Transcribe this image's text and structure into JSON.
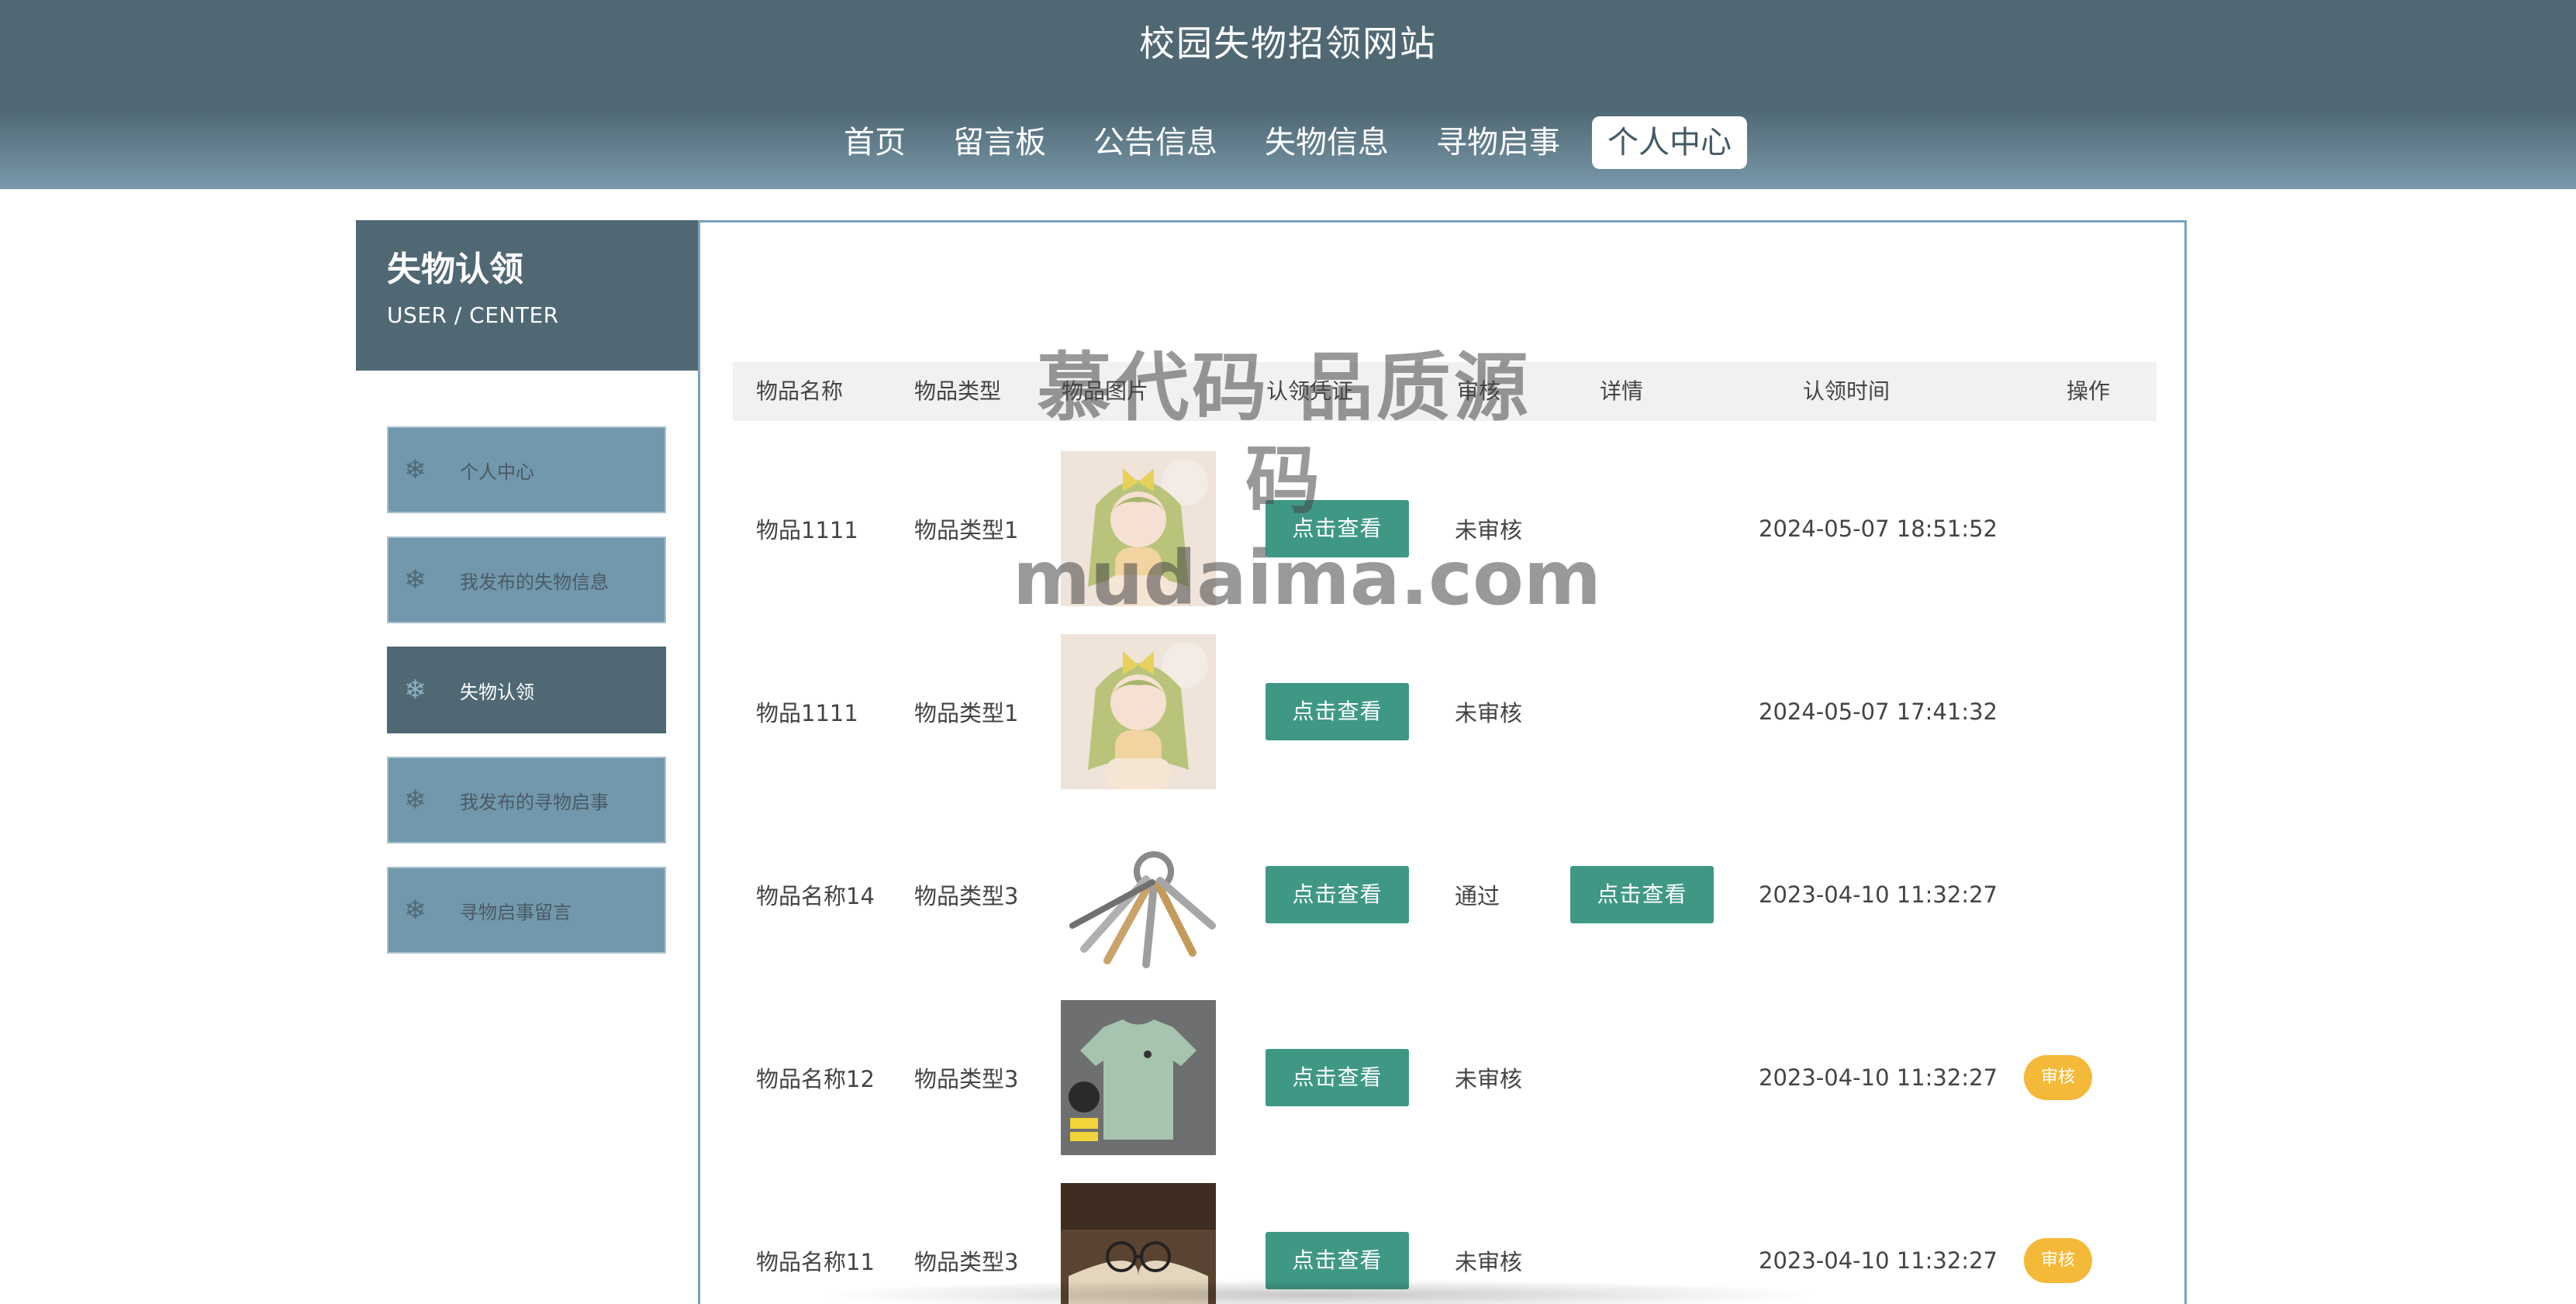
{
  "site": {
    "title": "校园失物招领网站"
  },
  "nav": {
    "items": [
      {
        "label": "首页"
      },
      {
        "label": "留言板"
      },
      {
        "label": "公告信息"
      },
      {
        "label": "失物信息"
      },
      {
        "label": "寻物启事"
      },
      {
        "label": "个人中心",
        "active": true
      }
    ]
  },
  "sidebar": {
    "title": "失物认领",
    "subtitle": "USER / CENTER",
    "items": [
      {
        "label": "个人中心",
        "icon": "snowflake-icon"
      },
      {
        "label": "我发布的失物信息",
        "icon": "snowflake-icon"
      },
      {
        "label": "失物认领",
        "icon": "snowflake-icon",
        "active": true
      },
      {
        "label": "我发布的寻物启事",
        "icon": "snowflake-icon"
      },
      {
        "label": "寻物启事留言",
        "icon": "snowflake-icon"
      }
    ]
  },
  "table": {
    "headers": {
      "name": "物品名称",
      "type": "物品类型",
      "image": "物品图片",
      "proof": "认领凭证",
      "audit": "审核",
      "detail": "详情",
      "time": "认领时间",
      "action": "操作"
    },
    "rows": [
      {
        "name": "物品1111",
        "type": "物品类型1",
        "image": "anime-girl-image",
        "proof_button": "点击查看",
        "audit": "未审核",
        "detail_button": "",
        "time": "2024-05-07 18:51:52",
        "action_button": ""
      },
      {
        "name": "物品1111",
        "type": "物品类型1",
        "image": "anime-girl-image",
        "proof_button": "点击查看",
        "audit": "未审核",
        "detail_button": "",
        "time": "2024-05-07 17:41:32",
        "action_button": ""
      },
      {
        "name": "物品名称14",
        "type": "物品类型3",
        "image": "keys-image",
        "proof_button": "点击查看",
        "audit": "通过",
        "detail_button": "点击查看",
        "time": "2023-04-10 11:32:27",
        "action_button": ""
      },
      {
        "name": "物品名称12",
        "type": "物品类型3",
        "image": "tshirt-image",
        "proof_button": "点击查看",
        "audit": "未审核",
        "detail_button": "",
        "time": "2023-04-10 11:32:27",
        "action_button": "审核"
      },
      {
        "name": "物品名称11",
        "type": "物品类型3",
        "image": "glasses-book-image",
        "proof_button": "点击查看",
        "audit": "未审核",
        "detail_button": "",
        "time": "2023-04-10 11:32:27",
        "action_button": "审核"
      }
    ]
  },
  "watermark": {
    "line1": "慕代码 品质源码",
    "line2": "mudaima.com"
  },
  "colors": {
    "header": "#4f6874",
    "sidebar_item": "#7198ad",
    "button_green": "#3f9886",
    "button_yellow": "#f5b93a"
  }
}
